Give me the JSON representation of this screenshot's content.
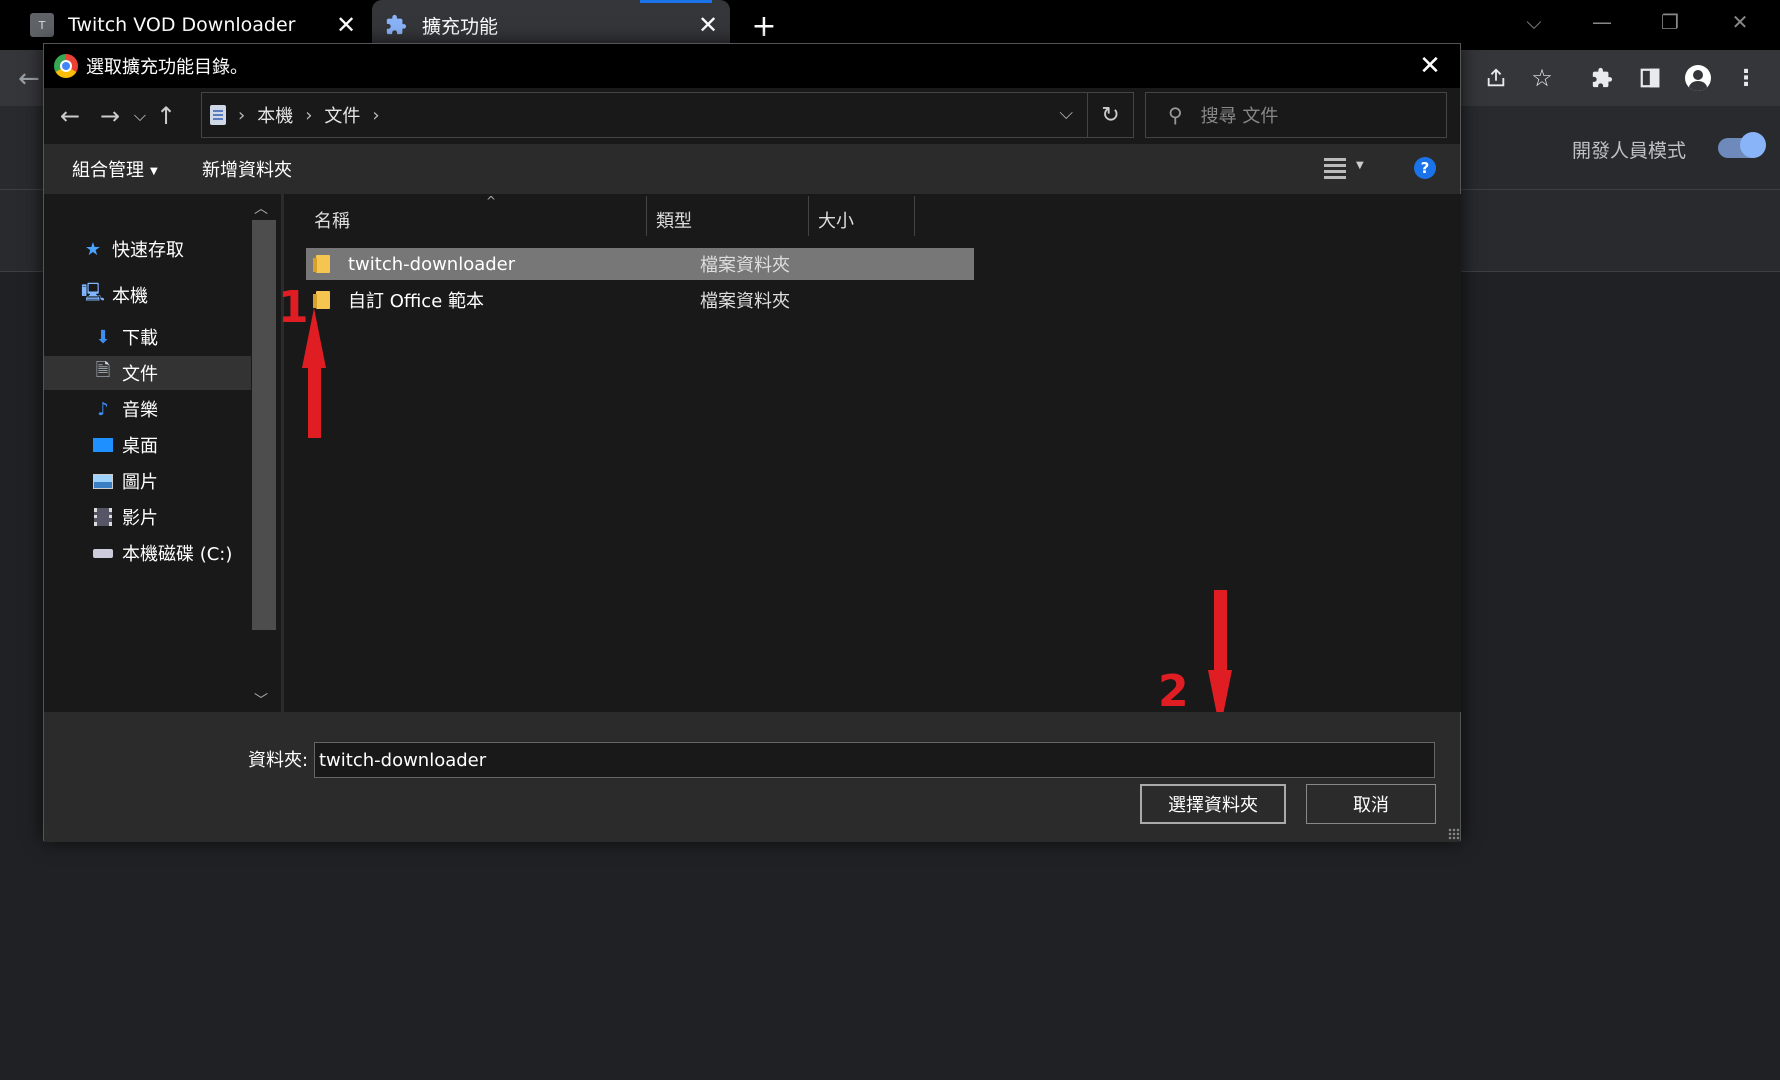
{
  "browser": {
    "tabs": [
      {
        "title": "Twitch VOD Downloader",
        "favicon": "T"
      },
      {
        "title": "擴充功能"
      }
    ],
    "new_tab_label": "+",
    "developer_mode_label": "開發人員模式",
    "developer_mode_on": true
  },
  "dialog": {
    "title": "選取擴充功能目錄。",
    "breadcrumb": [
      "本機",
      "文件"
    ],
    "search_placeholder": "搜尋 文件",
    "commands": {
      "organize": "組合管理",
      "new_folder": "新增資料夾",
      "help": "?"
    },
    "nav": {
      "quick_access": "快速存取",
      "this_pc": "本機",
      "items": [
        "下載",
        "文件",
        "音樂",
        "桌面",
        "圖片",
        "影片",
        "本機磁碟 (C:)"
      ],
      "selected": "文件"
    },
    "columns": [
      "名稱",
      "類型",
      "大小"
    ],
    "rows": [
      {
        "name": "twitch-downloader",
        "type": "檔案資料夾",
        "selected": true
      },
      {
        "name": "自訂 Office 範本",
        "type": "檔案資料夾",
        "selected": false
      }
    ],
    "folder_label": "資料夾:",
    "folder_value": "twitch-downloader",
    "select_button": "選擇資料夾",
    "cancel_button": "取消"
  },
  "annotations": {
    "step1": "1",
    "step2": "2",
    "color": "#e11d24"
  }
}
